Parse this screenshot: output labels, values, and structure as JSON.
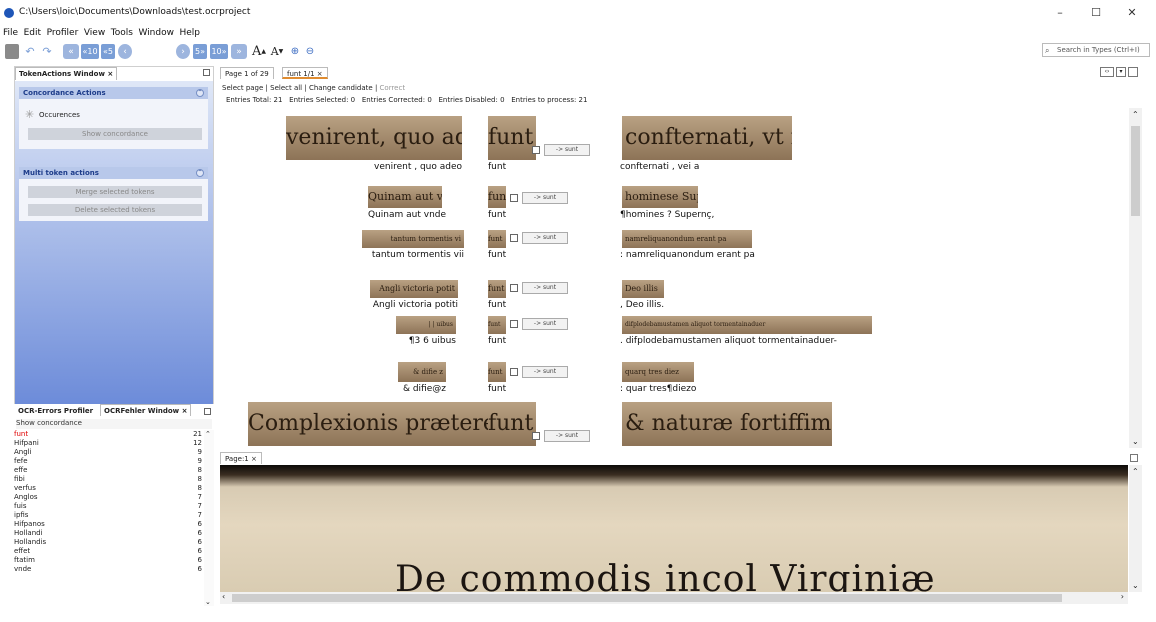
{
  "window": {
    "title": "C:\\Users\\loic\\Documents\\Downloads\\test.ocrproject",
    "min": "–",
    "max": "☐",
    "close": "✕"
  },
  "menu": [
    "File",
    "Edit",
    "Profiler",
    "View",
    "Tools",
    "Window",
    "Help"
  ],
  "toolbar": {
    "back10": "«10",
    "back5": "«5",
    "page_value": "1",
    "fwd5": "5»",
    "fwd10": "10»",
    "font_up": "A",
    "font_down": "A",
    "zoom_in_icon": "zoom-in-icon",
    "zoom_out_icon": "zoom-out-icon"
  },
  "search": {
    "placeholder": "Search in Types (Ctrl+I)"
  },
  "tokenactions": {
    "tab": "TokenActions Window ×",
    "concordance_title": "Concordance Actions",
    "occurences": "Occurences",
    "show_concordance": "Show concordance",
    "multi_title": "Multi token actions",
    "merge": "Merge selected tokens",
    "delete": "Delete selected tokens"
  },
  "profiler": {
    "tab1": "OCR-Errors Profiler",
    "tab2": "OCRFehler Window ×",
    "show_concordance": "Show concordance",
    "rows": [
      {
        "w": "funt",
        "c": "21"
      },
      {
        "w": "Hifpani",
        "c": "12"
      },
      {
        "w": "Angli",
        "c": "9"
      },
      {
        "w": "fefe",
        "c": "9"
      },
      {
        "w": "effe",
        "c": "8"
      },
      {
        "w": "fibi",
        "c": "8"
      },
      {
        "w": "verfus",
        "c": "8"
      },
      {
        "w": "Anglos",
        "c": "7"
      },
      {
        "w": "fuis",
        "c": "7"
      },
      {
        "w": "ipfis",
        "c": "7"
      },
      {
        "w": "Hifpanos",
        "c": "6"
      },
      {
        "w": "Hollandi",
        "c": "6"
      },
      {
        "w": "Hollandis",
        "c": "6"
      },
      {
        "w": "effet",
        "c": "6"
      },
      {
        "w": "ftatim",
        "c": "6"
      },
      {
        "w": "vnde",
        "c": "6"
      }
    ],
    "first_color": "#e00000"
  },
  "tabs": {
    "page": "Page 1 of 29",
    "funt": "funt 1/1 ×"
  },
  "actions": {
    "select_page": "Select page",
    "select_all": "Select all",
    "change_candidate": "Change candidate",
    "correct": "Correct"
  },
  "stats": {
    "total": "Entries Total: 21",
    "selected": "Entries Selected: 0",
    "corrected": "Entries Corrected: 0",
    "disabled": "Entries Disabled: 0",
    "to_process": "Entries to process: 21"
  },
  "concordance": {
    "button_label": "-> sunt",
    "rows": [
      {
        "left_img": "venirent, quo adeo",
        "left_txt": "venirent      ,  quo      adeo",
        "mid_img": "funt",
        "mid_txt": "funt",
        "right_img": "confternati, vt m",
        "right_txt": "confternati         ,  vei    a"
      },
      {
        "left_img": "Quinam aut vnde",
        "left_txt": "Quinam   aut vnde",
        "mid_img": "funt",
        "mid_txt": "funt",
        "right_img": "hominese Supernç",
        "right_txt": "¶homines ? Supernç,"
      },
      {
        "left_img": "tantum tormentis vi",
        "left_txt": "tantum tormentis vii",
        "mid_img": "funt",
        "mid_txt": "funt",
        "right_img": "namreliquanondum erant pa",
        "right_txt": ": namreliquanondum erant pa"
      },
      {
        "left_img": "Angli victoria potit",
        "left_txt": "Angli victoria potiti",
        "mid_img": "funt",
        "mid_txt": "funt",
        "right_img": "Deo illis",
        "right_txt": ", Deo illis."
      },
      {
        "left_img": "| | uibus",
        "left_txt": "¶3 6 uibus",
        "mid_img": "funt",
        "mid_txt": "funt",
        "right_img": "difplodebamustamen aliquot tormentainaduer",
        "right_txt": ". difplodebamustamen aliquot tormentainaduer-"
      },
      {
        "left_img": "& difie z",
        "left_txt": "& difie@z",
        "mid_img": "funt",
        "mid_txt": "funt",
        "right_img": "quarq tres diez",
        "right_txt": ": quar tres¶diezo"
      },
      {
        "left_img": "Complexionis præterea",
        "left_txt": "",
        "mid_img": "funt",
        "mid_txt": "",
        "right_img": "& naturæ fortiffimæ",
        "right_txt": ""
      }
    ]
  },
  "pageview": {
    "tab": "Page:1 ×",
    "heading": "De commodis incol Virginiæ"
  }
}
